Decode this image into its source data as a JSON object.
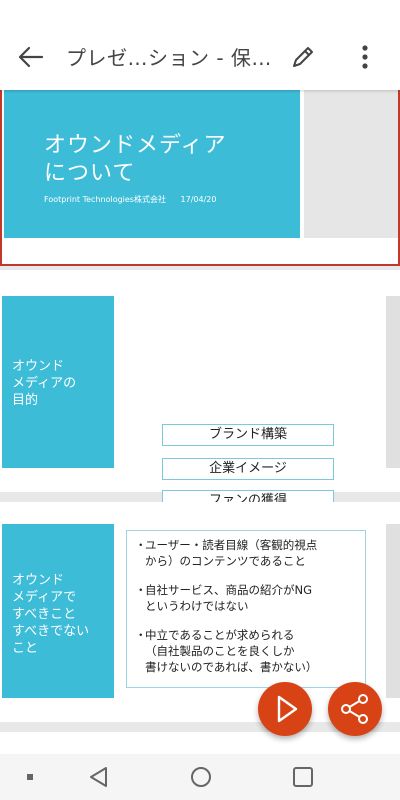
{
  "appbar": {
    "title": "プレゼ…ション - 保…",
    "icons": [
      "back-arrow-icon",
      "pencil-icon",
      "more-vertical-icon"
    ]
  },
  "slides": [
    {
      "title": "オウンドメディア\nについて",
      "company": "Footprint Technologies株式会社",
      "date": "17/04/20"
    },
    {
      "side_label": "オウンド\nメディアの\n目的",
      "keywords": [
        "ブランド構築",
        "企業イメージ",
        "ファンの獲得"
      ]
    },
    {
      "side_label": "オウンド\nメディアで\nすべきこと\nすべきでない\nこと",
      "bullets": [
        "ユーザー・読者目線（客観的視点\nから）のコンテンツであること",
        "自社サービス、商品の紹介がNG\nというわけではない",
        "中立であることが求められる\n（自社製品のことを良くしか\n書けないのであれば、書かない）"
      ]
    }
  ],
  "fabs": [
    "play-icon",
    "share-icon"
  ],
  "navbar": [
    "recent-apps-dot-icon",
    "back-triangle-icon",
    "home-circle-icon",
    "overview-square-icon"
  ],
  "colors": {
    "accent": "#3dbcd8",
    "fab": "#d84315",
    "selected_border": "#c0392b"
  }
}
